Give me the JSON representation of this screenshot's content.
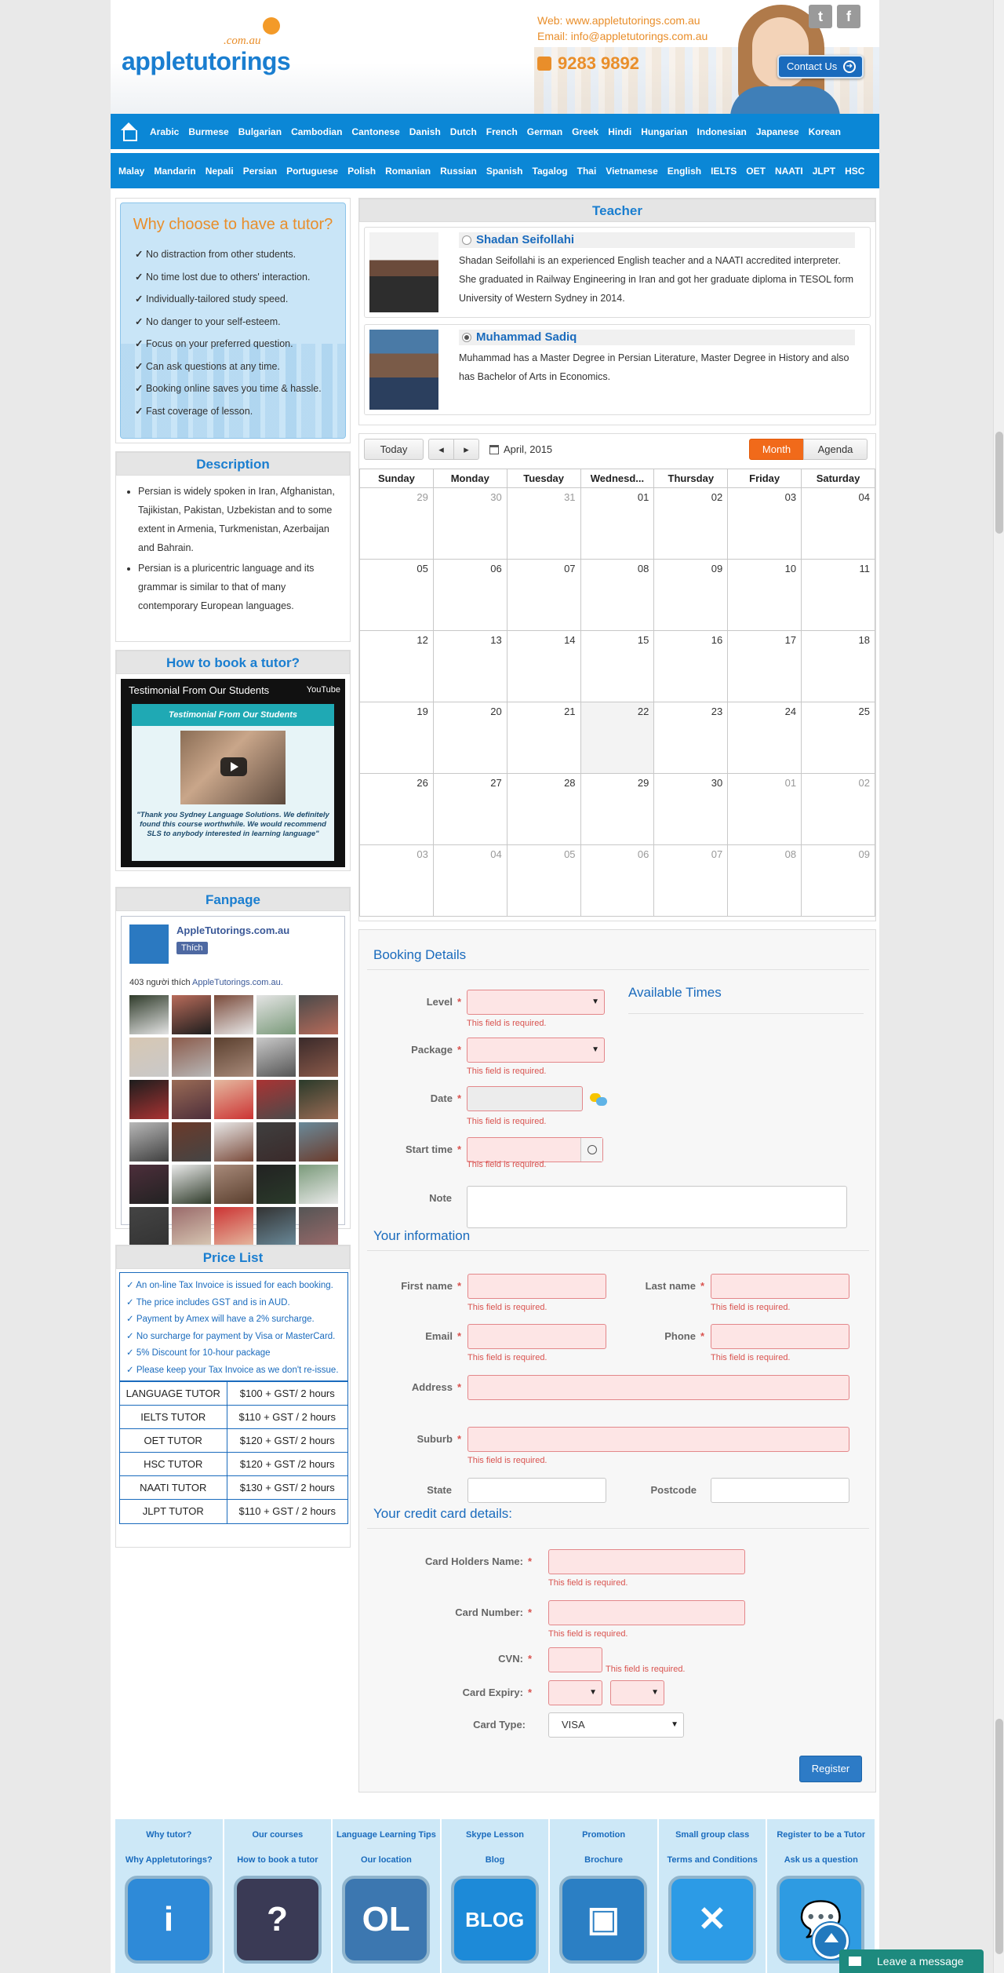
{
  "header": {
    "logo_domain": ".com.au",
    "logo_name": "appletutorings",
    "web": "Web: www.appletutorings.com.au",
    "email": "Email: info@appletutorings.com.au",
    "phone": "9283 9892",
    "twitter": "t",
    "facebook": "f",
    "contact_button": "Contact Us"
  },
  "nav": {
    "row1": [
      "Arabic",
      "Burmese",
      "Bulgarian",
      "Cambodian",
      "Cantonese",
      "Danish",
      "Dutch",
      "French",
      "German",
      "Greek",
      "Hindi",
      "Hungarian",
      "Indonesian",
      "Japanese",
      "Korean"
    ],
    "row2": [
      "Malay",
      "Mandarin",
      "Nepali",
      "Persian",
      "Portuguese",
      "Polish",
      "Romanian",
      "Russian",
      "Spanish",
      "Tagalog",
      "Thai",
      "Vietnamese",
      "English",
      "IELTS",
      "OET",
      "NAATI",
      "JLPT",
      "HSC"
    ]
  },
  "sidebar": {
    "why_title": "Why choose to have a tutor?",
    "why_items": [
      "No distraction from other students.",
      "No time lost due to others' interaction.",
      "Individually-tailored study speed.",
      "No danger to your self-esteem.",
      "Focus on your preferred question.",
      "Can ask questions at any time.",
      "Booking online saves you time & hassle.",
      "Fast coverage of lesson."
    ],
    "description_title": "Description",
    "description": [
      "Persian is widely spoken in Iran, Afghanistan, Tajikistan, Pakistan, Uzbekistan and to some extent in Armenia, Turkmenistan, Azerbaijan and Bahrain.",
      "Persian is a pluricentric language and its grammar is similar to that of many contemporary European languages."
    ],
    "howto_title": "How to book a tutor?",
    "video_title": "Testimonial From Our Students",
    "video_source": "YouTube",
    "video_band": "Testimonial From Our Students",
    "video_quote": "\"Thank you Sydney Language Solutions. We definitely found this course worthwhile. We would recommend SLS to anybody interested in learning language\"",
    "fanpage_title": "Fanpage",
    "fb_name": "AppleTutorings.com.au",
    "fb_like": "Thích",
    "fb_count": "403 người thích",
    "fb_count_link": "AppleTutorings.com.au.",
    "price_title": "Price List",
    "price_notes": [
      "An on-line Tax Invoice is issued for each booking.",
      "The price includes GST and is in AUD.",
      "Payment by Amex will have a 2% surcharge.",
      "No surcharge for payment by Visa or MasterCard.",
      "5% Discount for 10-hour package",
      "Please keep your Tax Invoice as we don't re-issue."
    ],
    "prices": [
      {
        "name": "LANGUAGE TUTOR",
        "price": "$100 + GST/ 2 hours"
      },
      {
        "name": "IELTS TUTOR",
        "price": "$110 + GST / 2 hours"
      },
      {
        "name": "OET TUTOR",
        "price": "$120 + GST/ 2 hours"
      },
      {
        "name": "HSC TUTOR",
        "price": "$120 + GST /2 hours"
      },
      {
        "name": "NAATI TUTOR",
        "price": "$130 + GST/ 2 hours"
      },
      {
        "name": "JLPT TUTOR",
        "price": "$110 + GST / 2 hours"
      }
    ]
  },
  "teacher": {
    "title": "Teacher",
    "list": [
      {
        "name": "Shadan Seifollahi",
        "selected": false,
        "bio": "Shadan Seifollahi is an experienced English teacher and a NAATI accredited interpreter. She graduated in Railway Engineering in Iran and got her graduate diploma in TESOL form University of Western Sydney in 2014."
      },
      {
        "name": "Muhammad Sadiq",
        "selected": true,
        "bio": "Muhammad has a Master Degree in Persian Literature, Master Degree in History and also has Bachelor of Arts in Economics."
      }
    ]
  },
  "calendar": {
    "today_button": "Today",
    "prev": "◂",
    "next": "▸",
    "label": "April, 2015",
    "month_button": "Month",
    "agenda_button": "Agenda",
    "days": [
      "Sunday",
      "Monday",
      "Tuesday",
      "Wednesd...",
      "Thursday",
      "Friday",
      "Saturday"
    ],
    "weeks": [
      [
        "29",
        "30",
        "31",
        "01",
        "02",
        "03",
        "04"
      ],
      [
        "05",
        "06",
        "07",
        "08",
        "09",
        "10",
        "11"
      ],
      [
        "12",
        "13",
        "14",
        "15",
        "16",
        "17",
        "18"
      ],
      [
        "19",
        "20",
        "21",
        "22",
        "23",
        "24",
        "25"
      ],
      [
        "26",
        "27",
        "28",
        "29",
        "30",
        "01",
        "02"
      ],
      [
        "03",
        "04",
        "05",
        "06",
        "07",
        "08",
        "09"
      ]
    ]
  },
  "booking": {
    "title": "Booking Details",
    "available_times": "Available Times",
    "level": "Level",
    "package": "Package",
    "date": "Date",
    "start_time": "Start time",
    "note": "Note",
    "required": "This field is required.",
    "your_info": "Your information",
    "first_name": "First name",
    "last_name": "Last name",
    "email": "Email",
    "phone": "Phone",
    "address": "Address",
    "suburb": "Suburb",
    "state": "State",
    "postcode": "Postcode",
    "credit_title": "Your credit card details:",
    "card_holder": "Card Holders Name:",
    "card_number": "Card Number:",
    "cvn": "CVN:",
    "card_expiry": "Card Expiry:",
    "card_type": "Card Type:",
    "card_type_value": "VISA",
    "register": "Register"
  },
  "footer": {
    "cols": [
      {
        "l1": "Why tutor?",
        "l2": "Why Appletutorings?",
        "glyph": "i",
        "color": "#2e8ad8"
      },
      {
        "l1": "Our courses",
        "l2": "How to book a tutor",
        "glyph": "?",
        "color": "#3a3a55"
      },
      {
        "l1": "Language Learning Tips",
        "l2": "Our location",
        "glyph": "OL",
        "color": "#3c77b0"
      },
      {
        "l1": "Skype Lesson",
        "l2": "Blog",
        "glyph": "BLOG",
        "color": "#1d8ad8"
      },
      {
        "l1": "Promotion",
        "l2": "Brochure",
        "glyph": "▣",
        "color": "#2b7fc4"
      },
      {
        "l1": "Small group class",
        "l2": "Terms and Conditions",
        "glyph": "✕",
        "color": "#2c9be6"
      },
      {
        "l1": "Register to be a Tutor",
        "l2": "Ask us a question",
        "glyph": "💬",
        "color": "#2e9be2"
      }
    ],
    "leave_message": "Leave a message"
  }
}
